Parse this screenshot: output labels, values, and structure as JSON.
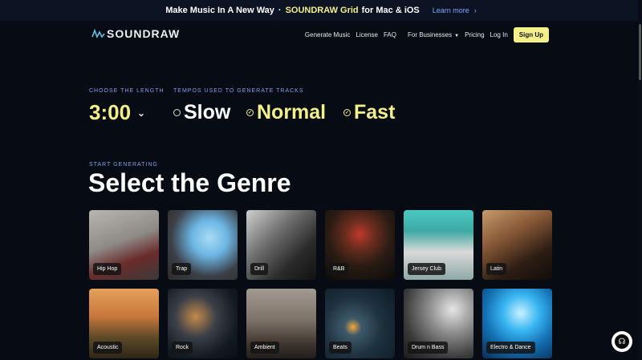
{
  "banner": {
    "pre": "Make Music In A New Way",
    "dot": "·",
    "grid": "SOUNDRAW Grid",
    "post": "for Mac & iOS",
    "learn": "Learn more",
    "chev": "›"
  },
  "nav": {
    "logo": "SOUNDRAW",
    "items": [
      "Generate Music",
      "License",
      "FAQ",
      "For Businesses",
      "Pricing",
      "Log In"
    ],
    "caret": "▼",
    "signup": "Sign Up"
  },
  "length": {
    "label": "CHOOSE THE LENGTH",
    "value": "3:00",
    "dropdown_icon": "chevron-down-icon",
    "dropdown_glyph": "⌄"
  },
  "tempos": {
    "label": "TEMPOS USED TO GENERATE TRACKS",
    "items": [
      {
        "label": "Slow",
        "selected": false,
        "glyph": ""
      },
      {
        "label": "Normal",
        "selected": true,
        "glyph": "✓"
      },
      {
        "label": "Fast",
        "selected": true,
        "glyph": "✓"
      }
    ]
  },
  "genre_section": {
    "kicker": "START GENERATING",
    "title": "Select the Genre",
    "genres": [
      "Hip Hop",
      "Trap",
      "Drill",
      "R&B",
      "Jersey Club",
      "Latin",
      "Acoustic",
      "Rock",
      "Ambient",
      "Beats",
      "Drum n Bass",
      "Electro & Dance"
    ]
  },
  "support": {
    "icon": "headset-icon",
    "glyph": "☊"
  },
  "colors": {
    "accent": "#f3f08a",
    "label_blue": "#7da3e8",
    "background": "#070b14"
  }
}
